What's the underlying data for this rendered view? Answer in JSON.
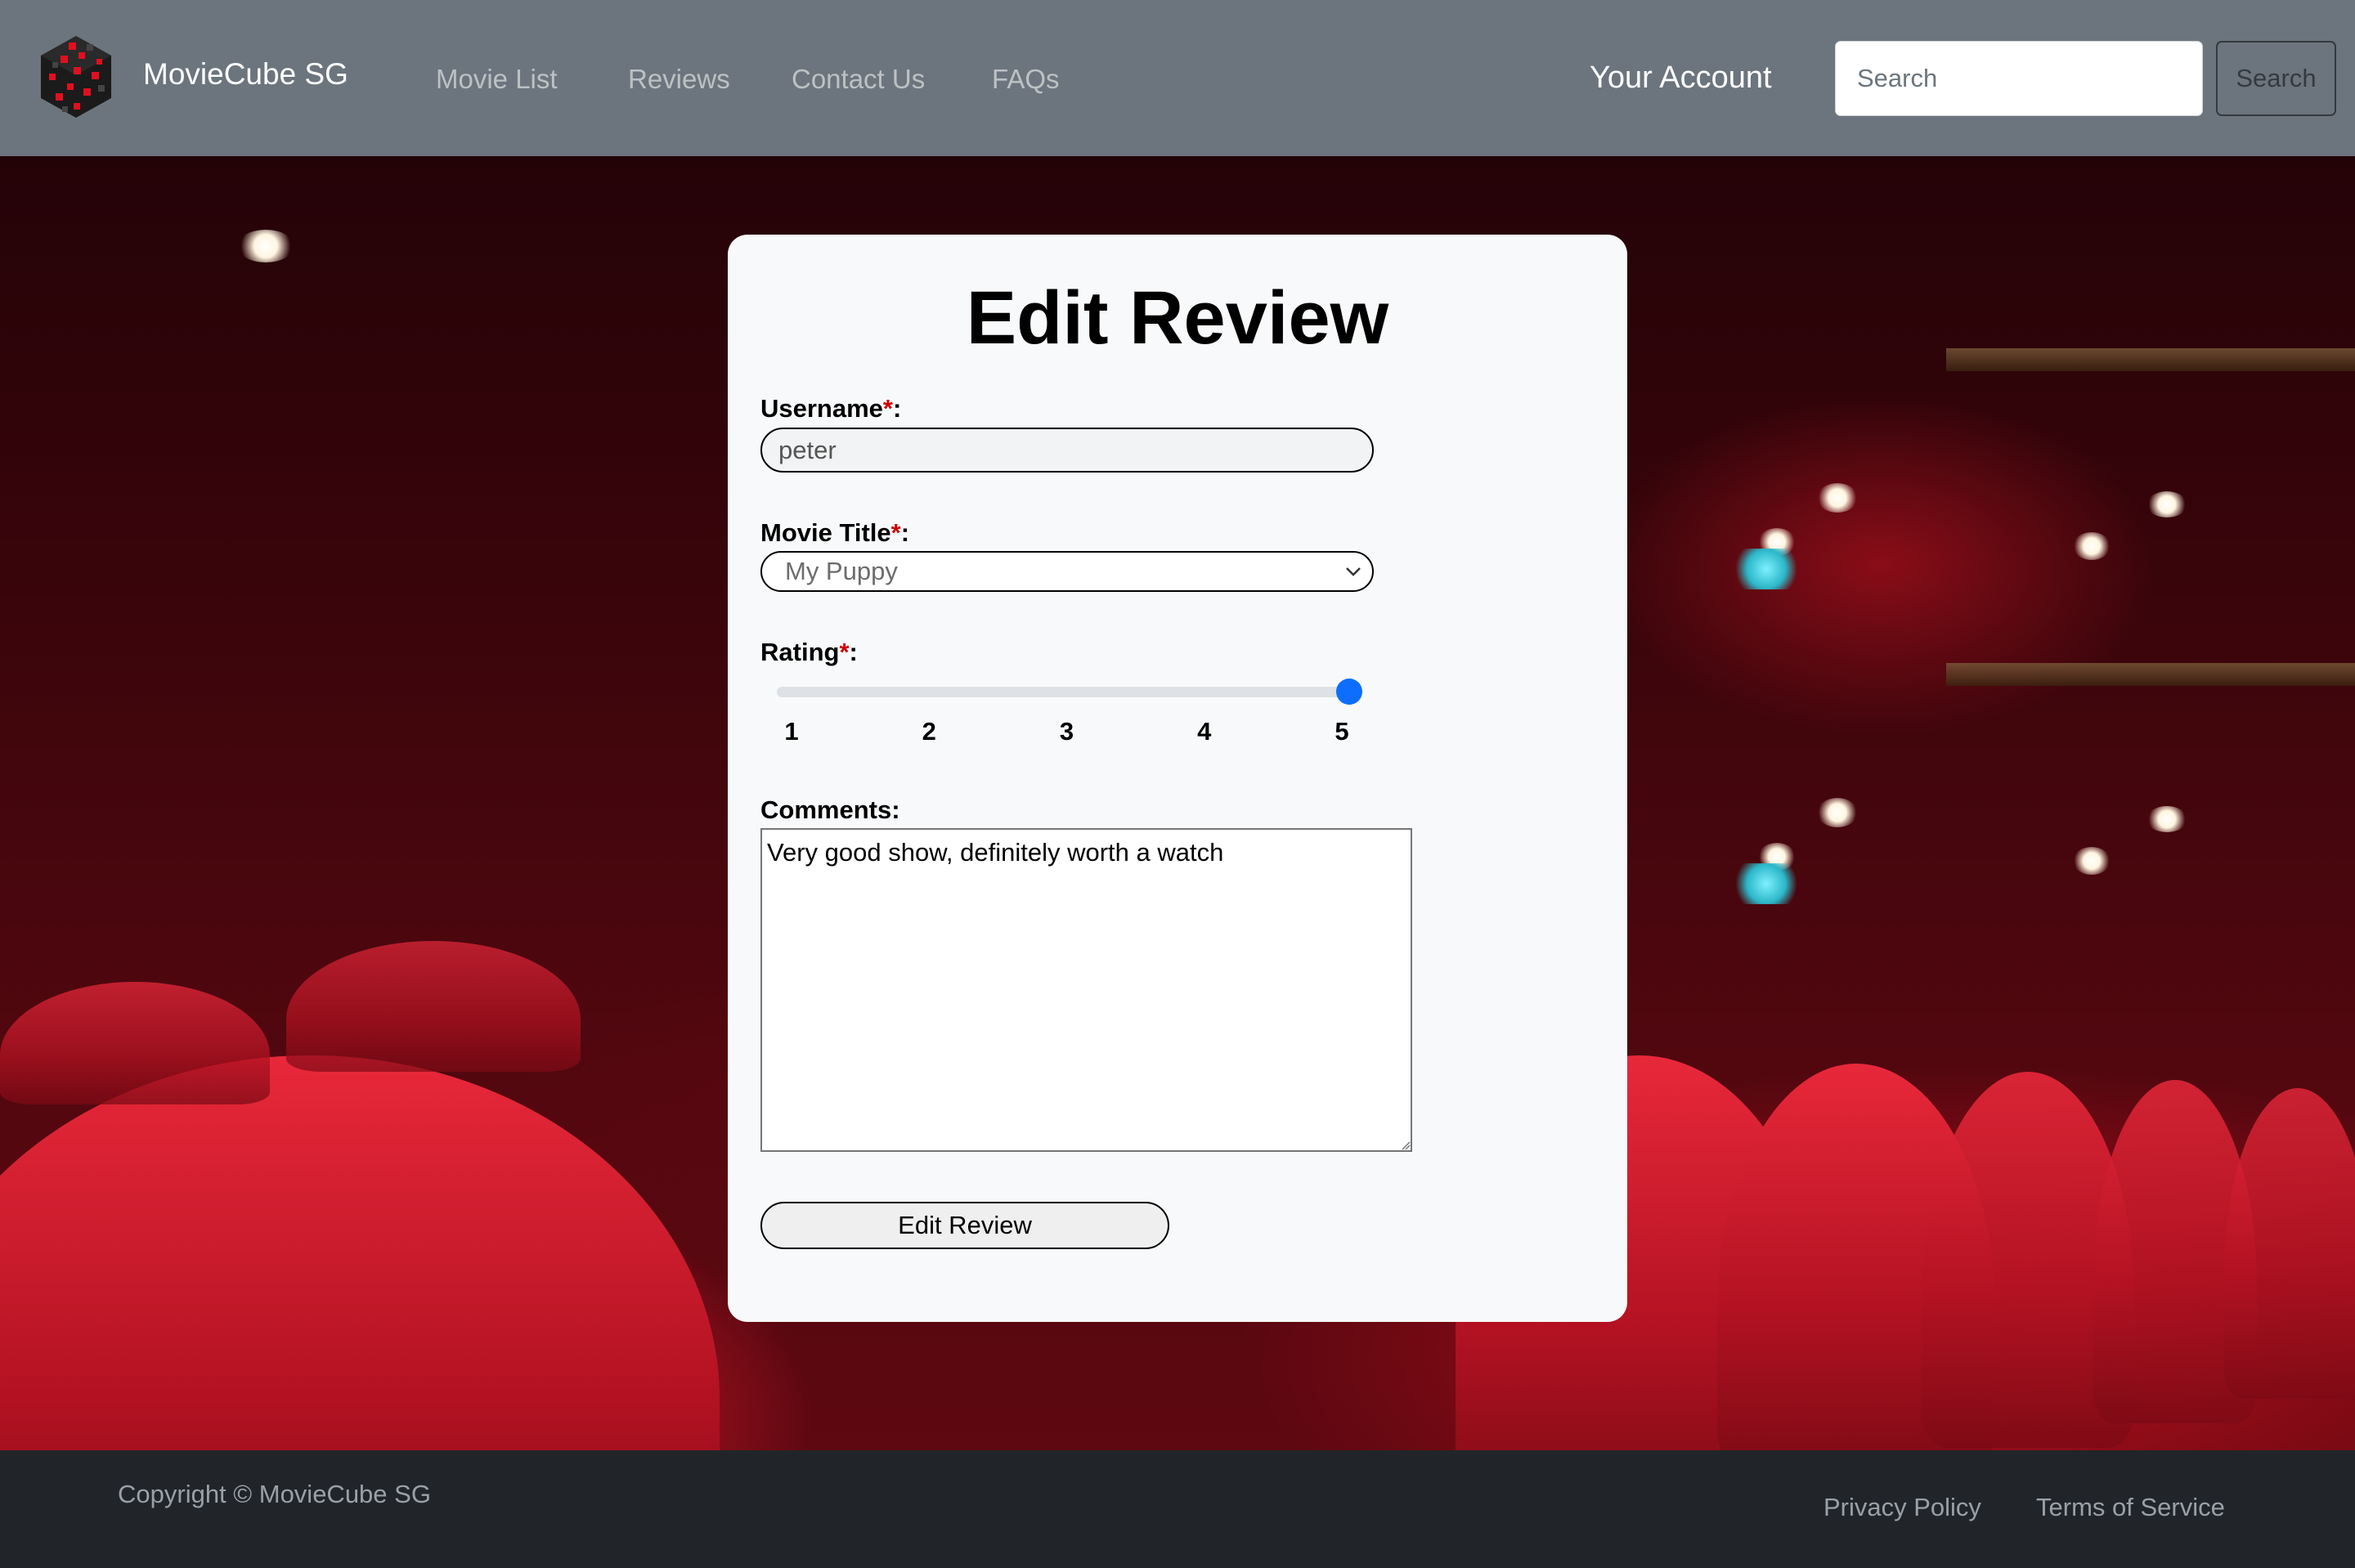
{
  "app": {
    "brand_name": "MovieCube SG",
    "logo_icon": "red-cube-logo-icon"
  },
  "nav": {
    "links": [
      "Movie List",
      "Reviews",
      "Contact Us",
      "FAQs"
    ],
    "account_label": "Your Account",
    "search_placeholder": "Search",
    "search_button_label": "Search"
  },
  "form": {
    "title": "Edit Review",
    "required_marker": "*",
    "username": {
      "label": "Username",
      "suffix": ":",
      "value": "peter"
    },
    "movie_title": {
      "label": "Movie Title",
      "suffix": ":",
      "selected": "My Puppy"
    },
    "rating": {
      "label": "Rating",
      "suffix": ":",
      "min": 1,
      "max": 5,
      "value": 5,
      "ticks": [
        "1",
        "2",
        "3",
        "4",
        "5"
      ]
    },
    "comments": {
      "label": "Comments:",
      "value": "Very good show, definitely worth a watch"
    },
    "submit_label": "Edit Review"
  },
  "footer": {
    "copyright": "Copyright © MovieCube SG",
    "privacy_label": "Privacy Policy",
    "terms_label": "Terms of Service"
  },
  "colors": {
    "navbar": "#6c757d",
    "footer": "#212529",
    "accent": "#0d6efd",
    "required": "#d00000",
    "card": "#f8f9fa"
  }
}
